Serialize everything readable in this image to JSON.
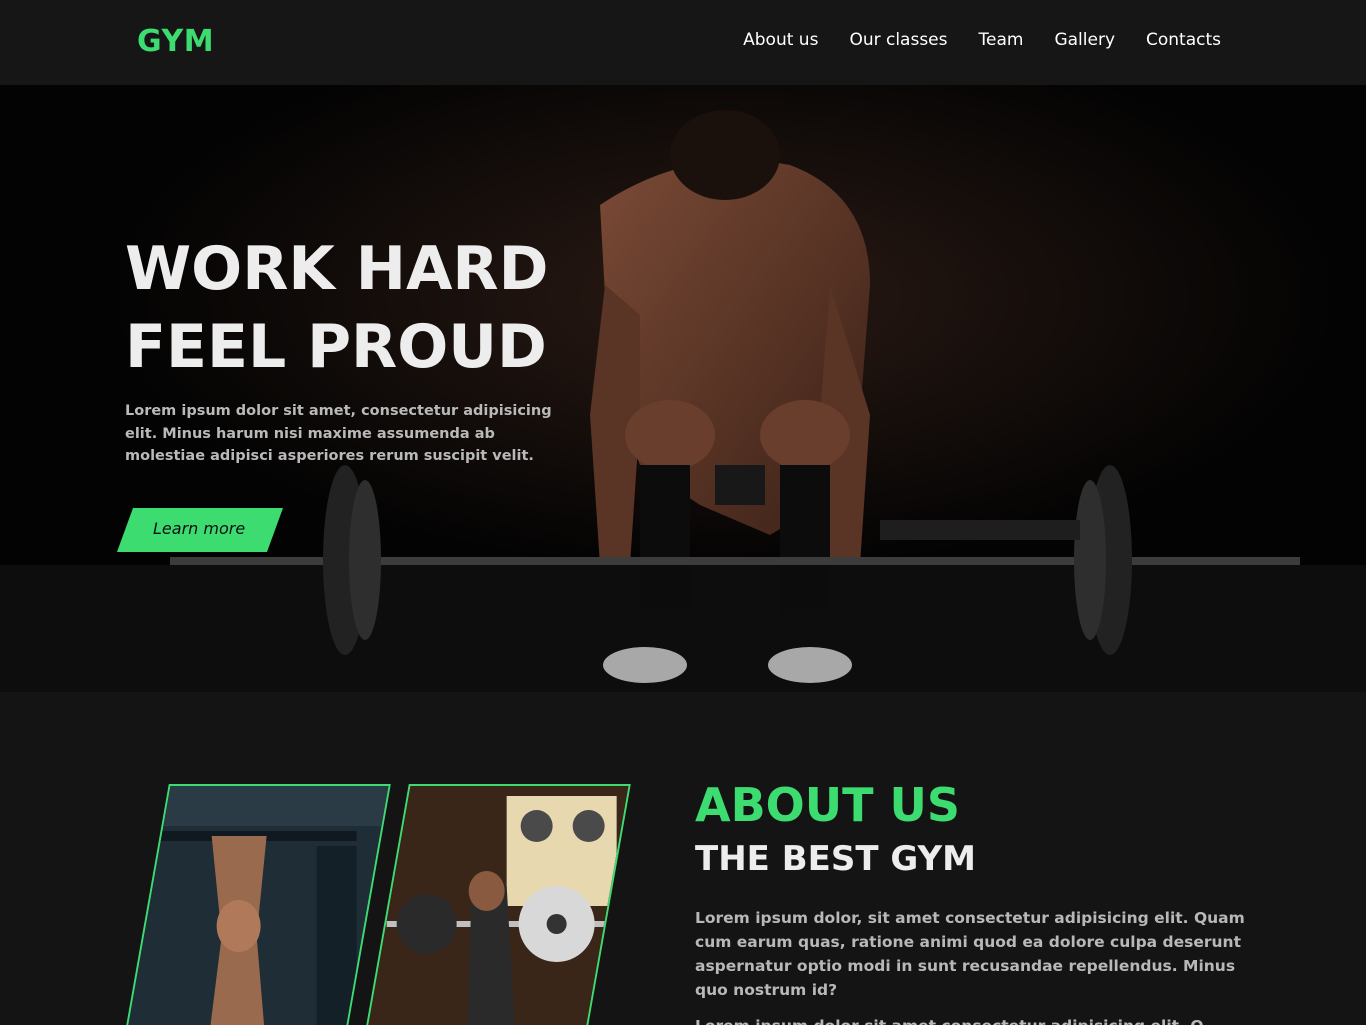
{
  "brand": {
    "logo": "GYM",
    "accent_color": "#3ddc71"
  },
  "nav": {
    "items": [
      {
        "label": "About us"
      },
      {
        "label": "Our classes"
      },
      {
        "label": "Team"
      },
      {
        "label": "Gallery"
      },
      {
        "label": "Contacts"
      }
    ]
  },
  "hero": {
    "title_line_1": "WORK HARD",
    "title_line_2": "FEEL PROUD",
    "text": "Lorem ipsum dolor sit amet, consectetur adipisicing elit. Minus harum nisi maxime assumenda ab molestiae adipisci asperiores rerum suscipit velit.",
    "cta_label": "Learn more"
  },
  "about": {
    "title": "ABOUT US",
    "subtitle": "THE BEST GYM",
    "text": "Lorem ipsum dolor, sit amet consectetur adipisicing elit. Quam cum earum quas, ratione animi quod ea dolore culpa deserunt aspernatur optio modi in sunt recusandae repellendus. Minus quo nostrum id?",
    "text_2": "Lorem ipsum dolor sit amet consectetur adipisicing elit. Q"
  }
}
